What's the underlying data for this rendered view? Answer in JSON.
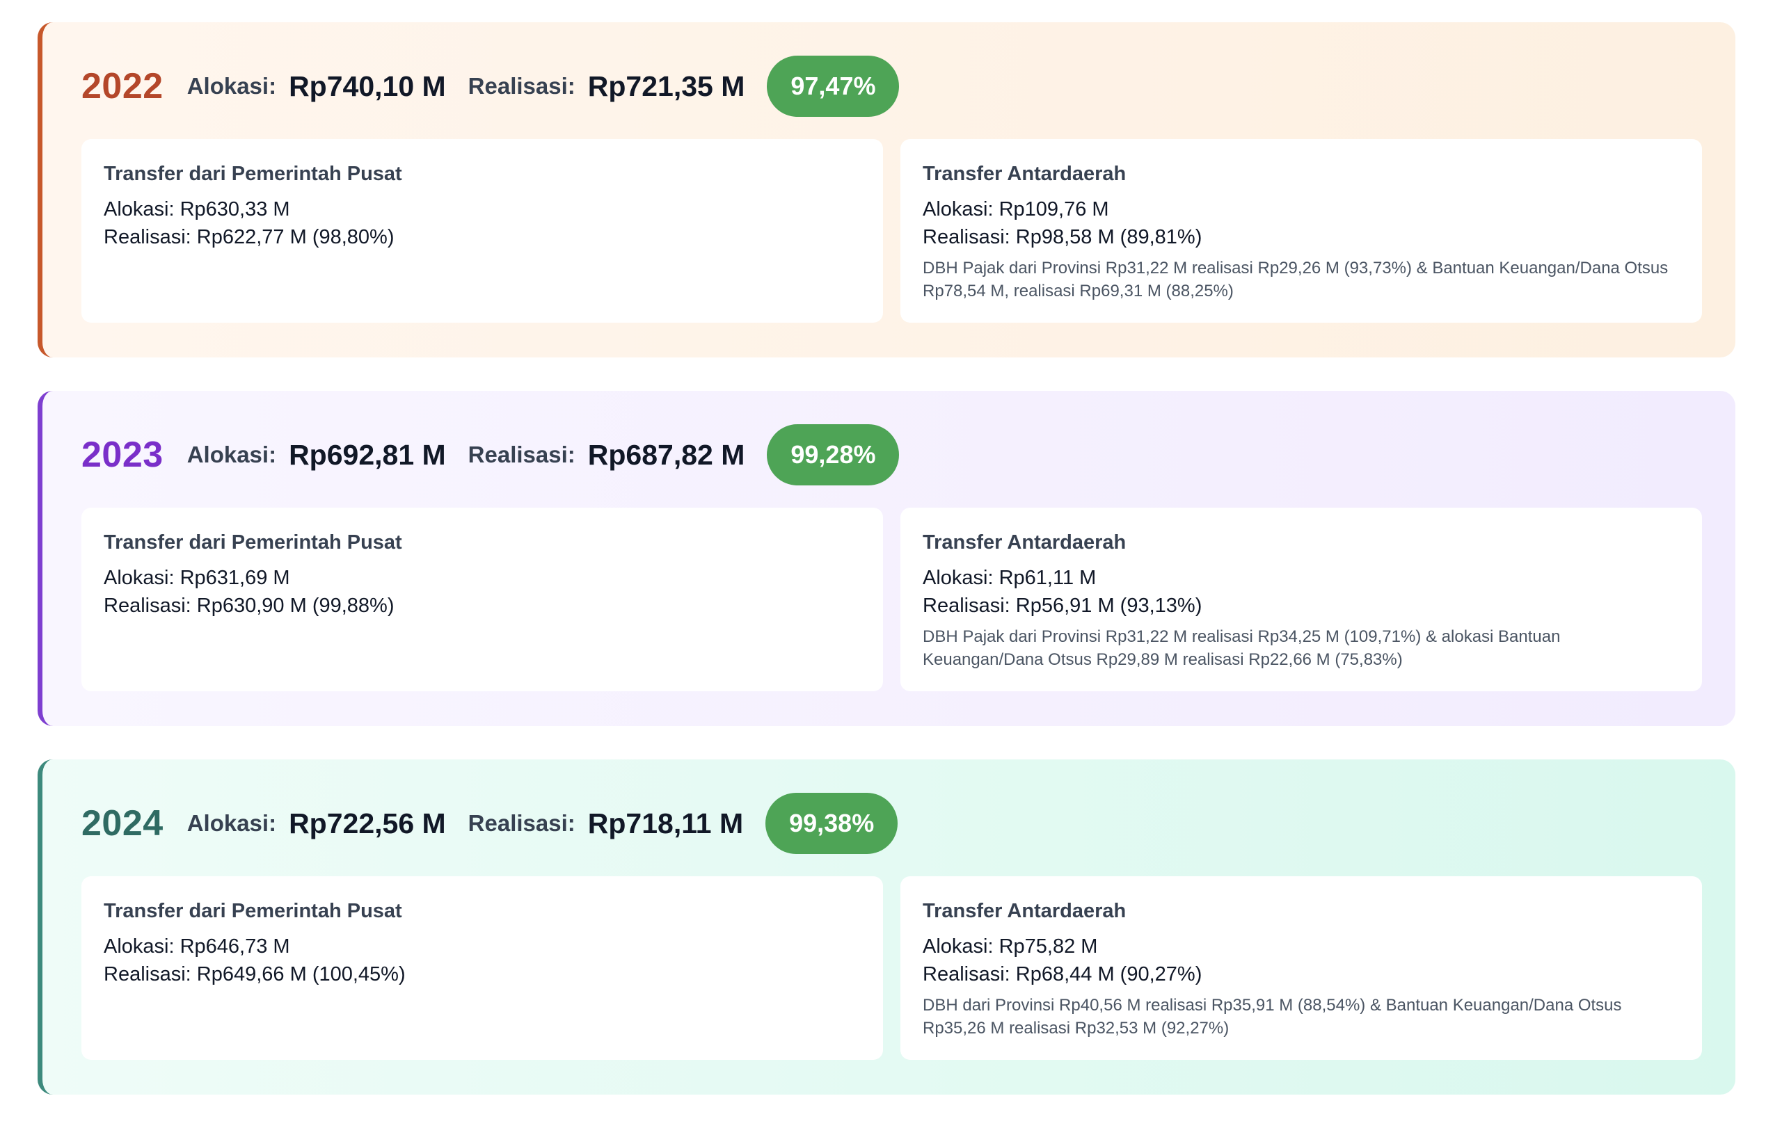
{
  "years": [
    {
      "year": "2022",
      "alokasi_label": "Alokasi:",
      "alokasi_value": "Rp740,10 M",
      "realisasi_label": "Realisasi:",
      "realisasi_value": "Rp721,35 M",
      "percentage": "97,47%",
      "left_panel": {
        "title": "Transfer dari Pemerintah Pusat",
        "alokasi": "Alokasi: Rp630,33 M",
        "realisasi": "Realisasi: Rp622,77 M (98,80%)"
      },
      "right_panel": {
        "title": "Transfer Antardaerah",
        "alokasi": "Alokasi: Rp109,76 M",
        "realisasi": "Realisasi: Rp98,58 M (89,81%)",
        "note": "DBH Pajak dari Provinsi Rp31,22 M realisasi Rp29,26 M (93,73%) & Bantuan Keuangan/Dana Otsus Rp78,54 M, realisasi Rp69,31 M (88,25%)"
      }
    },
    {
      "year": "2023",
      "alokasi_label": "Alokasi:",
      "alokasi_value": "Rp692,81 M",
      "realisasi_label": "Realisasi:",
      "realisasi_value": "Rp687,82 M",
      "percentage": "99,28%",
      "left_panel": {
        "title": "Transfer dari Pemerintah Pusat",
        "alokasi": "Alokasi: Rp631,69 M",
        "realisasi": "Realisasi: Rp630,90 M (99,88%)"
      },
      "right_panel": {
        "title": "Transfer Antardaerah",
        "alokasi": "Alokasi: Rp61,11 M",
        "realisasi": "Realisasi: Rp56,91 M (93,13%)",
        "note": "DBH Pajak dari Provinsi Rp31,22 M realisasi Rp34,25 M (109,71%) & alokasi Bantuan Keuangan/Dana Otsus Rp29,89 M realisasi Rp22,66 M (75,83%)"
      }
    },
    {
      "year": "2024",
      "alokasi_label": "Alokasi:",
      "alokasi_value": "Rp722,56 M",
      "realisasi_label": "Realisasi:",
      "realisasi_value": "Rp718,11 M",
      "percentage": "99,38%",
      "left_panel": {
        "title": "Transfer dari Pemerintah Pusat",
        "alokasi": "Alokasi: Rp646,73 M",
        "realisasi": "Realisasi: Rp649,66 M (100,45%)"
      },
      "right_panel": {
        "title": "Transfer Antardaerah",
        "alokasi": "Alokasi: Rp75,82 M",
        "realisasi": "Realisasi: Rp68,44 M (90,27%)",
        "note": "DBH dari Provinsi Rp40,56 M realisasi Rp35,91 M (88,54%) & Bantuan Keuangan/Dana Otsus Rp35,26 M realisasi Rp32,53 M (92,27%)"
      }
    }
  ],
  "colors": {
    "badge": "#4ea456",
    "year_2022": "#b4472a",
    "year_2023": "#7a2fc9",
    "year_2024": "#2f6b63",
    "accent_2022": "#c7582b",
    "accent_2023": "#7e3fd0",
    "accent_2024": "#3d8a7d"
  }
}
